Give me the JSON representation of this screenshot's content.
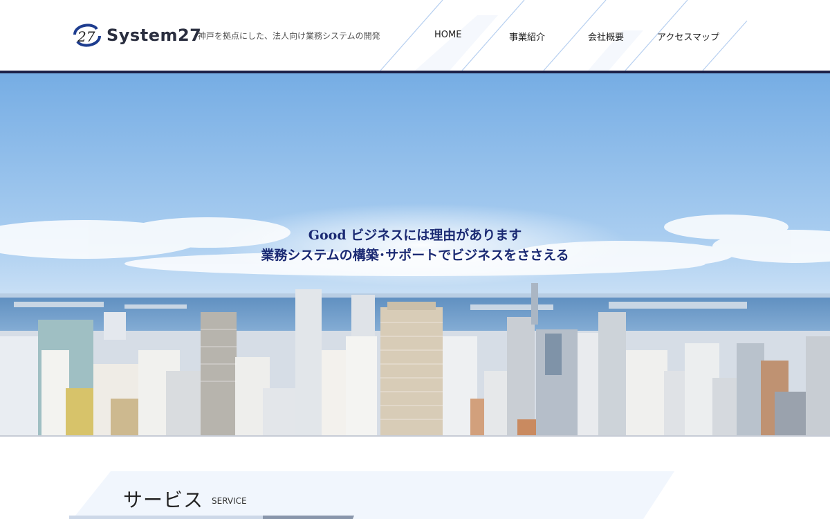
{
  "site": {
    "logo_name": "System27",
    "tagline": "神戸を拠点にした、法人向け業務システムの開発"
  },
  "nav": {
    "items": [
      {
        "label": "HOME"
      },
      {
        "label": "事業紹介"
      },
      {
        "label": "会社概要"
      },
      {
        "label": "アクセスマップ"
      }
    ]
  },
  "hero": {
    "line1": "Good ビジネスには理由があります",
    "line2": "業務システムの構築･サポートでビジネスをささえる"
  },
  "section": {
    "title": "サービス",
    "subtitle": "SERVICE"
  },
  "colors": {
    "brand_navy": "#1d2147",
    "hero_text": "#1b2a73",
    "sky_top": "#7fb3e6",
    "accent_slash": "#a9c8ee"
  }
}
